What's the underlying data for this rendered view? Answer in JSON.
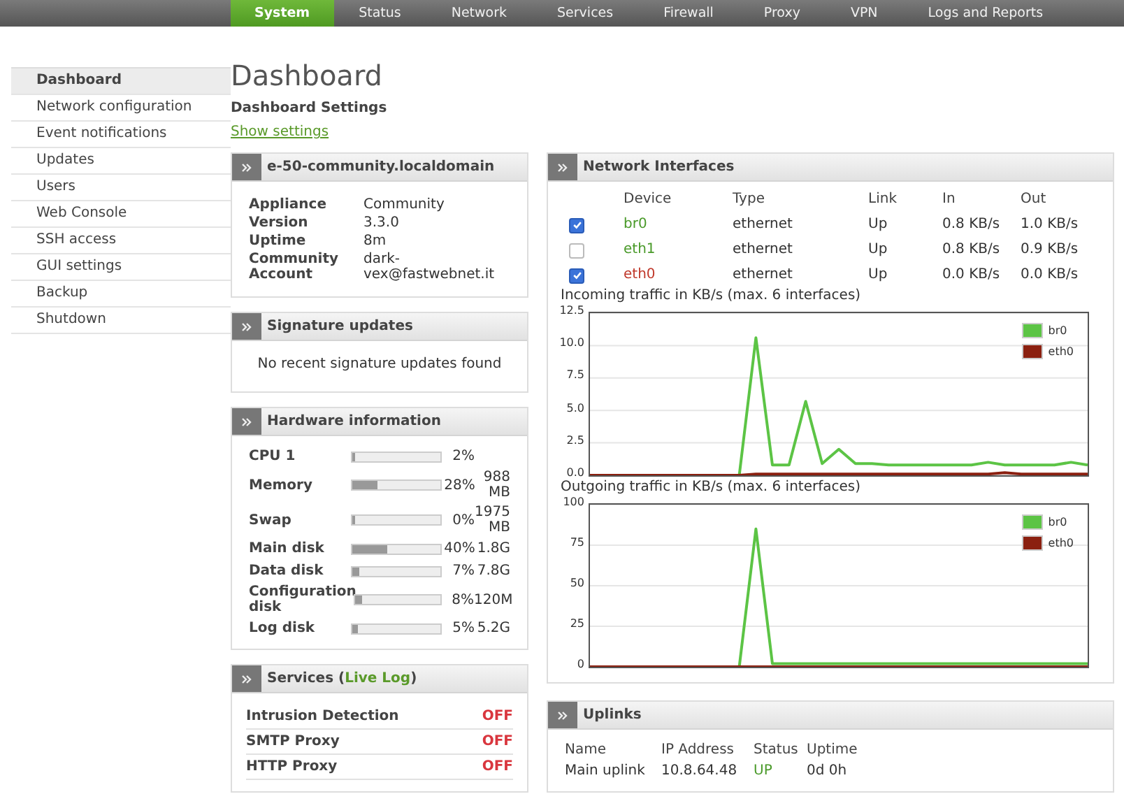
{
  "top_nav": [
    {
      "label": "System",
      "selected": true
    },
    {
      "label": "Status",
      "selected": false
    },
    {
      "label": "Network",
      "selected": false
    },
    {
      "label": "Services",
      "selected": false
    },
    {
      "label": "Firewall",
      "selected": false
    },
    {
      "label": "Proxy",
      "selected": false
    },
    {
      "label": "VPN",
      "selected": false
    },
    {
      "label": "Logs and Reports",
      "selected": false
    }
  ],
  "sidebar": {
    "items": [
      {
        "label": "Dashboard",
        "selected": true
      },
      {
        "label": "Network configuration",
        "selected": false
      },
      {
        "label": "Event notifications",
        "selected": false
      },
      {
        "label": "Updates",
        "selected": false
      },
      {
        "label": "Users",
        "selected": false
      },
      {
        "label": "Web Console",
        "selected": false
      },
      {
        "label": "SSH access",
        "selected": false
      },
      {
        "label": "GUI settings",
        "selected": false
      },
      {
        "label": "Backup",
        "selected": false
      },
      {
        "label": "Shutdown",
        "selected": false
      }
    ]
  },
  "page": {
    "title": "Dashboard",
    "subtitle": "Dashboard Settings",
    "link": "Show settings"
  },
  "host_panel": {
    "title": "e-50-community.localdomain",
    "rows": [
      {
        "label": "Appliance",
        "value": "Community"
      },
      {
        "label": "Version",
        "value": "3.3.0"
      },
      {
        "label": "Uptime",
        "value": "8m"
      },
      {
        "label": "Community Account",
        "value": "dark-vex@fastwebnet.it"
      }
    ]
  },
  "signature_panel": {
    "title": "Signature updates",
    "message": "No recent signature updates found"
  },
  "hardware_panel": {
    "title": "Hardware information",
    "rows": [
      {
        "label": "CPU 1",
        "level": 0.02,
        "percent": "2%"
      },
      {
        "label": "Memory",
        "level": 0.28,
        "percent": "28%",
        "size": "988 MB"
      },
      {
        "label": "Swap",
        "level": 0.0,
        "percent": "0%",
        "size": "1975 MB"
      },
      {
        "label": "Main disk",
        "level": 0.4,
        "percent": "40%",
        "size": "1.8G"
      },
      {
        "label": "Data disk",
        "level": 0.07,
        "percent": "7%",
        "size": "7.8G"
      },
      {
        "label": "Configuration disk",
        "level": 0.08,
        "percent": "8%",
        "size": "120M"
      },
      {
        "label": "Log disk",
        "level": 0.05,
        "percent": "5%",
        "size": "5.2G"
      }
    ]
  },
  "services_panel": {
    "title": "Services (",
    "link": "Live Log",
    "title_end": ")",
    "rows": [
      {
        "name": "Intrusion Detection",
        "status": "OFF",
        "on": false
      },
      {
        "name": "SMTP Proxy",
        "status": "OFF",
        "on": false
      },
      {
        "name": "HTTP Proxy",
        "status": "OFF",
        "on": false
      }
    ]
  },
  "interfaces_panel": {
    "title": "Network Interfaces",
    "columns": [
      "Device",
      "Type",
      "Link",
      "In",
      "Out"
    ],
    "rows": [
      {
        "checked": true,
        "device": "br0",
        "color": "#4a9a2a",
        "type": "ethernet",
        "link": "Up",
        "in": "0.8 KB/s",
        "out": "1.0 KB/s"
      },
      {
        "checked": false,
        "device": "eth1",
        "color": "#4a9a2a",
        "type": "ethernet",
        "link": "Up",
        "in": "0.8 KB/s",
        "out": "0.9 KB/s"
      },
      {
        "checked": true,
        "device": "eth0",
        "color": "#c0392b",
        "type": "ethernet",
        "link": "Up",
        "in": "0.0 KB/s",
        "out": "0.0 KB/s"
      }
    ],
    "charts": [
      {
        "chart_data": {
          "type": "line",
          "title": "Incoming traffic in KB/s (max. 6 interfaces)",
          "grid": true,
          "legend": true,
          "ylim": [
            0,
            12.5
          ],
          "yticks": [
            {
              "value": 0,
              "label": "0.0"
            },
            {
              "value": 2.5,
              "label": "2.5"
            },
            {
              "value": 5,
              "label": "5.0"
            },
            {
              "value": 7.5,
              "label": "7.5"
            },
            {
              "value": 10,
              "label": "10.0"
            },
            {
              "value": 12.5,
              "label": "12.5"
            }
          ],
          "series": [
            {
              "name": "br0",
              "color": "#5cc445",
              "values": [
                null,
                null,
                null,
                null,
                null,
                null,
                null,
                null,
                null,
                0,
                10.6,
                0.8,
                0.8,
                5.7,
                0.9,
                2.0,
                0.9,
                0.9,
                0.8,
                0.8,
                0.8,
                0.8,
                0.8,
                0.8,
                1.0,
                0.8,
                0.8,
                0.8,
                0.8,
                1.0,
                0.8
              ]
            },
            {
              "name": "eth0",
              "color": "#8b2010",
              "values": [
                0,
                0,
                0,
                0,
                0,
                0,
                0,
                0,
                0,
                0,
                0.1,
                0.1,
                0.1,
                0.1,
                0.1,
                0.1,
                0.1,
                0.1,
                0.1,
                0.1,
                0.1,
                0.1,
                0.1,
                0.1,
                0.1,
                0.2,
                0.1,
                0.1,
                0.1,
                0.1,
                0.1
              ]
            }
          ]
        }
      },
      {
        "chart_data": {
          "type": "line",
          "title": "Outgoing traffic in KB/s (max. 6 interfaces)",
          "grid": true,
          "legend": true,
          "ylim": [
            0,
            100
          ],
          "yticks": [
            0,
            25,
            50,
            75,
            100
          ],
          "series": [
            {
              "name": "br0",
              "color": "#5cc445",
              "values": [
                null,
                null,
                null,
                null,
                null,
                null,
                null,
                null,
                null,
                0,
                85,
                2,
                2,
                2,
                2,
                2,
                2,
                2,
                2,
                2,
                2,
                2,
                2,
                2,
                2,
                2,
                2,
                2,
                2,
                2,
                2
              ]
            },
            {
              "name": "eth0",
              "color": "#8b2010",
              "values": [
                0,
                0,
                0,
                0,
                0,
                0,
                0,
                0,
                0,
                0,
                0,
                0,
                0,
                0,
                0,
                0,
                0,
                0,
                0,
                0,
                0,
                0,
                0,
                0,
                0,
                0,
                0,
                0,
                0,
                0,
                0
              ]
            }
          ]
        }
      }
    ]
  },
  "uplinks_panel": {
    "title": "Uplinks",
    "columns": [
      "Name",
      "IP Address",
      "Status",
      "Uptime"
    ],
    "rows": [
      {
        "name": "Main uplink",
        "ip": "10.8.64.48",
        "status": "UP",
        "up": true,
        "uptime": "0d 0h"
      }
    ]
  }
}
